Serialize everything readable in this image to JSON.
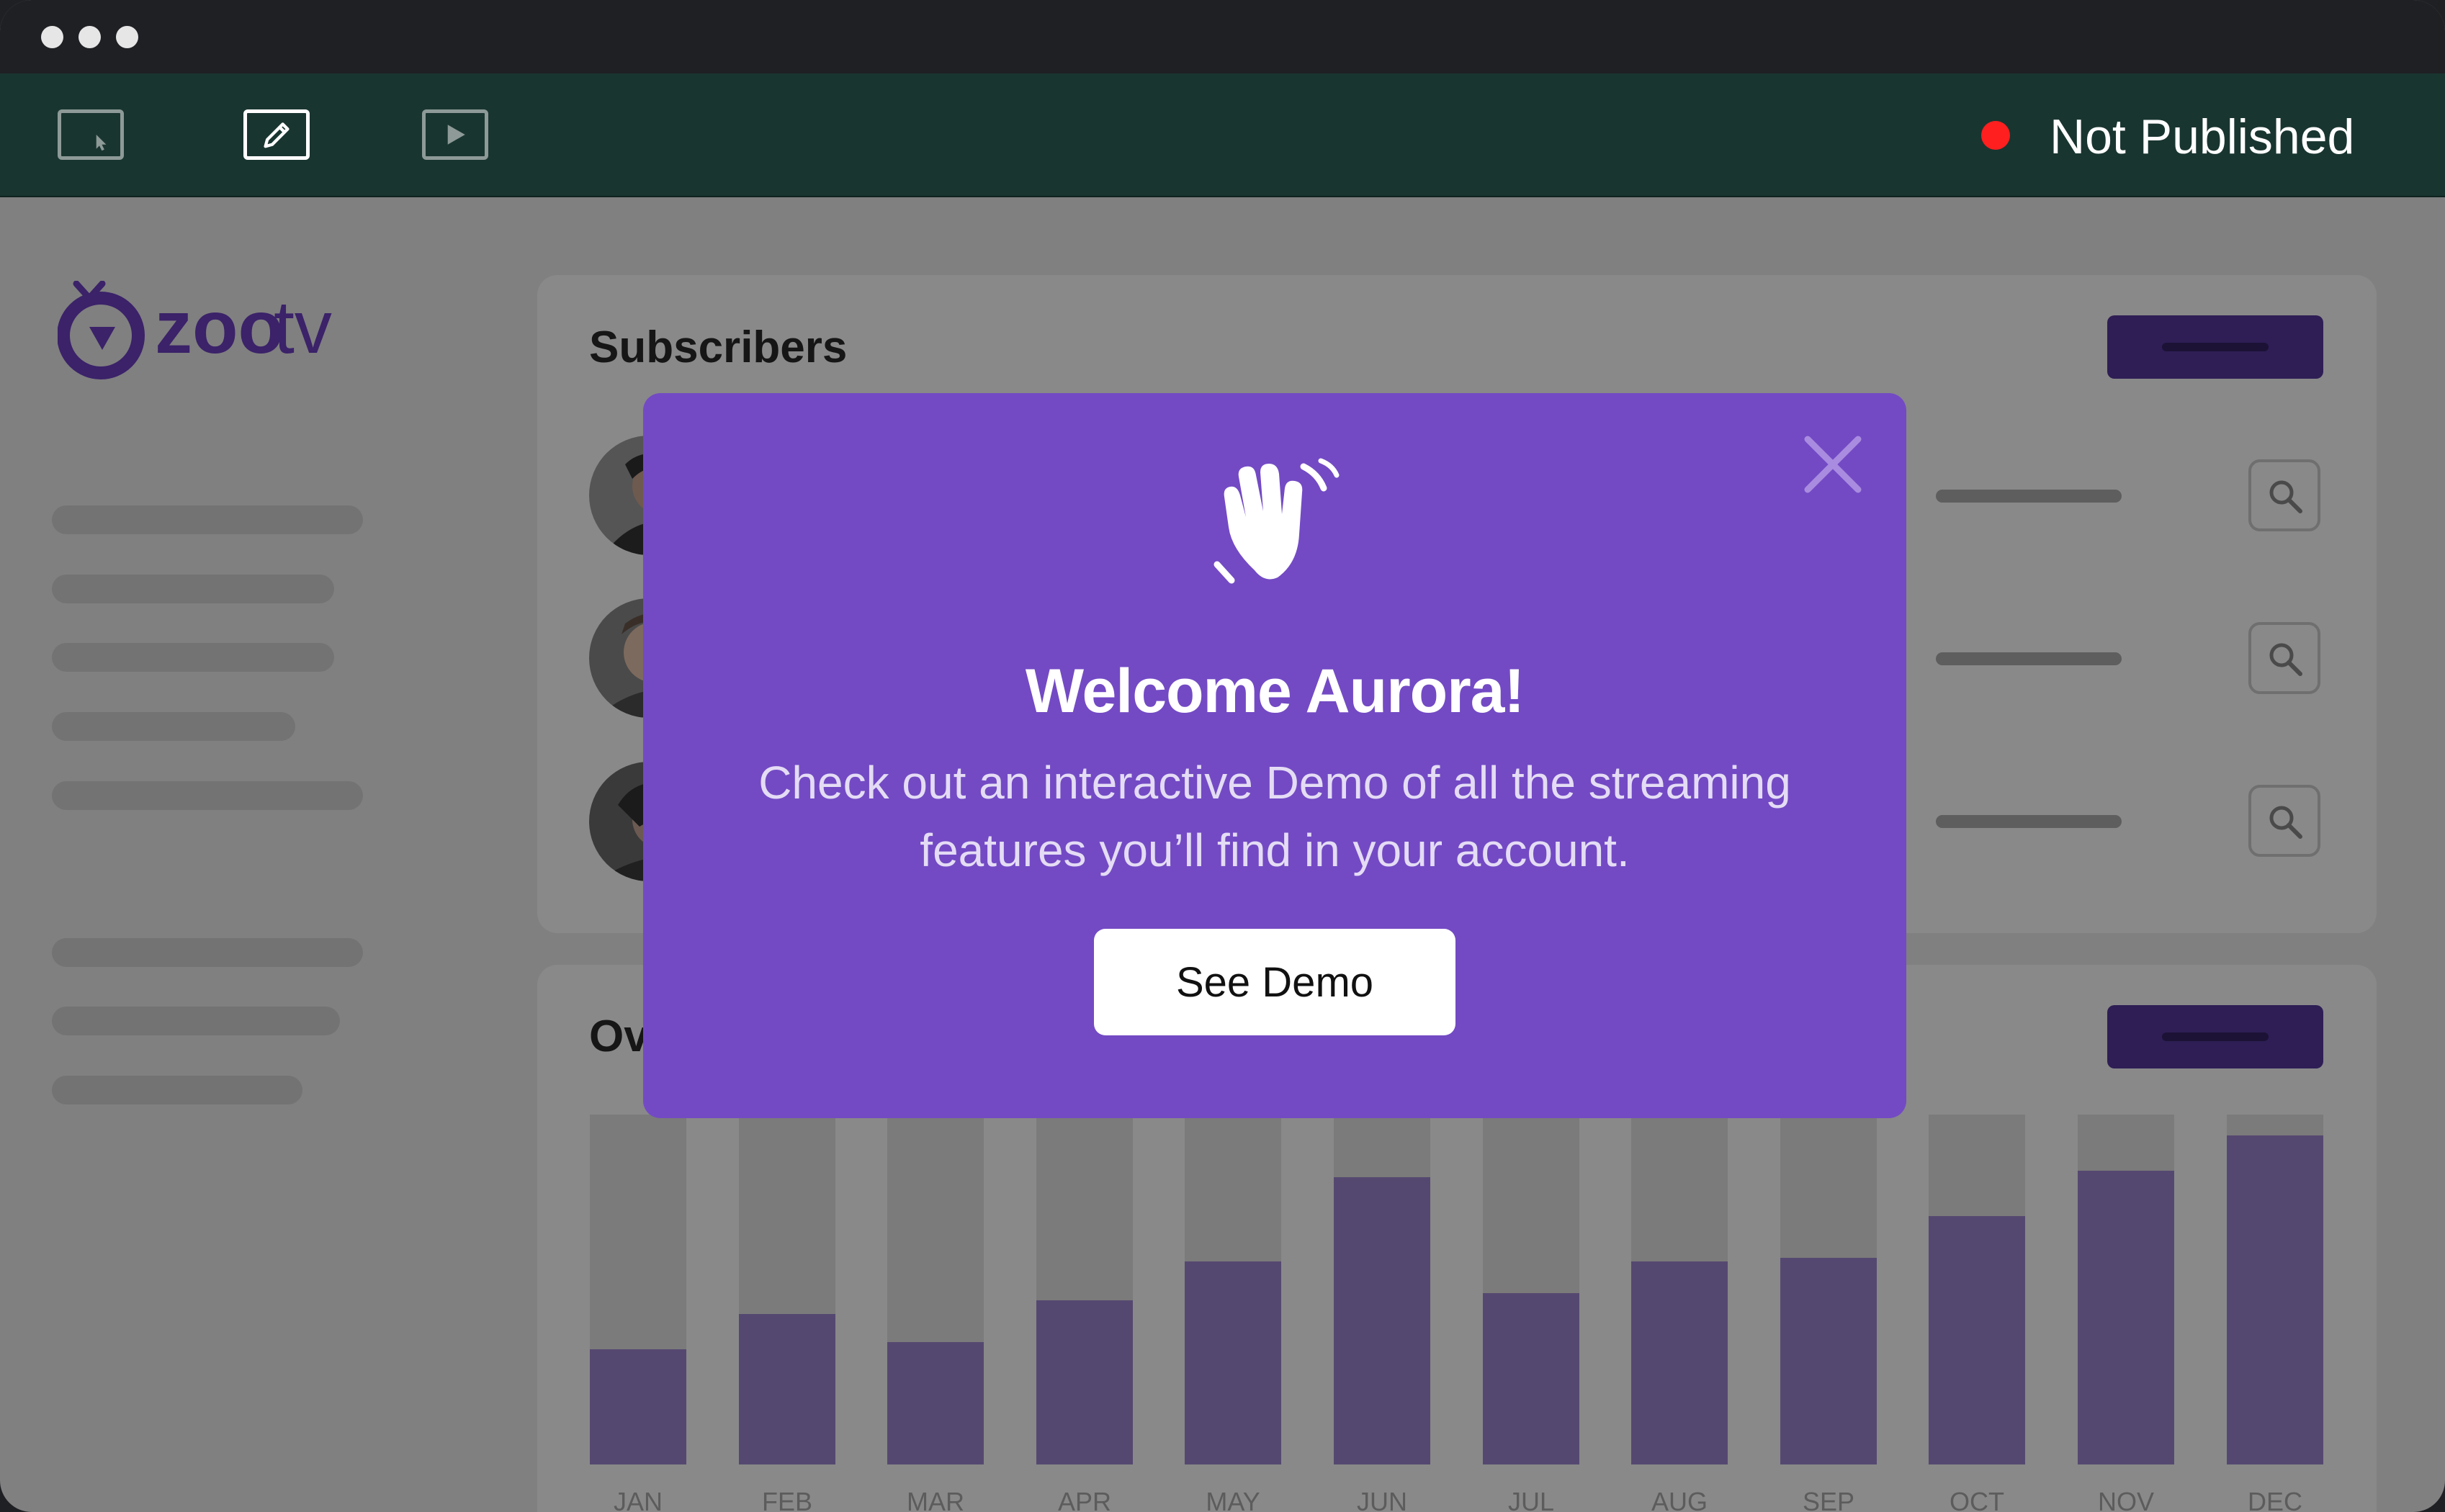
{
  "toolbar": {
    "tools": [
      "pointer-tool",
      "edit-tool",
      "preview-tool"
    ],
    "active_tool": "edit-tool",
    "status": {
      "label": "Not Published",
      "color": "#ff1f1f"
    }
  },
  "brand": {
    "name_bold": "zoo",
    "name_light": "tv",
    "color": "#3b2269"
  },
  "subscribers": {
    "title": "Subscribers",
    "rows": [
      {
        "avatar": "avatar-1"
      },
      {
        "avatar": "avatar-2"
      },
      {
        "avatar": "avatar-3"
      }
    ]
  },
  "overview": {
    "title_visible": "Ov"
  },
  "chart_data": {
    "type": "bar",
    "categories": [
      "JAN",
      "FEB",
      "MAR",
      "APR",
      "MAY",
      "JUN",
      "JUL",
      "AUG",
      "SEP",
      "OCT",
      "NOV",
      "DEC"
    ],
    "values": [
      33,
      43,
      35,
      47,
      58,
      82,
      49,
      58,
      59,
      71,
      84,
      94
    ],
    "ylim": [
      0,
      100
    ],
    "bar_color": "#554870",
    "track_color": "#7b7b7b",
    "grid": false
  },
  "modal": {
    "icon": "waving-hand-icon",
    "title": "Welcome Aurora!",
    "text": "Check out an interactive Demo of all the streaming features you’ll find in your account.",
    "button_label": "See Demo",
    "background": "#734ac4"
  }
}
